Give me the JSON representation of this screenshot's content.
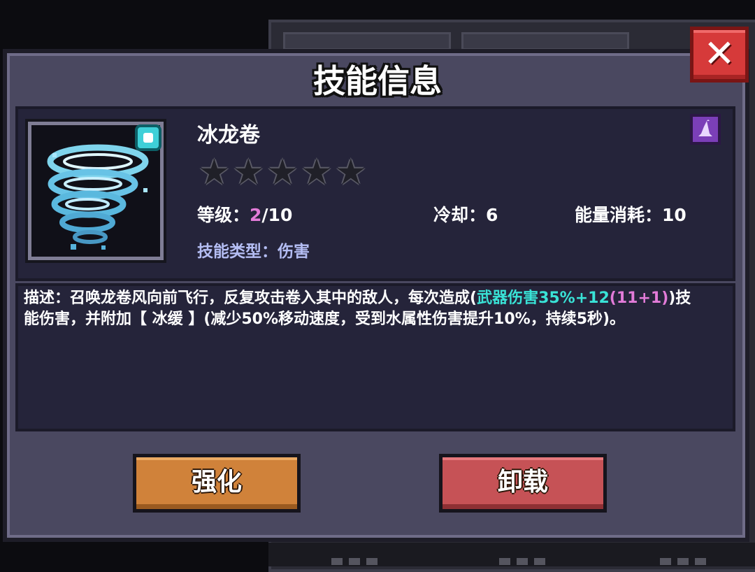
{
  "dialog": {
    "title": "技能信息",
    "close_label": "✕"
  },
  "skill": {
    "icon": "tornado-icon",
    "name": "冰龙卷",
    "stars_total": 5,
    "stars_filled": 0,
    "level_label": "等级：",
    "level_current": "2",
    "level_max": "/10",
    "cooldown": "冷却：6",
    "energy_cost": "能量消耗：10",
    "type": "技能类型：伤害",
    "class_badge_icon": "wizard-hat-icon"
  },
  "description": {
    "part1": "描述：召唤龙卷风向前飞行，反复攻击卷入其中的敌人，每次造成(",
    "damage_formula": "武器伤害35%+12",
    "upgrade_note": "(11+1)",
    "part2": ")技能伤害，并附加【 冰缓 】(减少50%移动速度，受到水属性伤害提升10%，持续5秒)。"
  },
  "buttons": {
    "upgrade": "强化",
    "unequip": "卸载"
  },
  "colors": {
    "highlight_pink": "#e27bd8",
    "highlight_cyan": "#39e2d6",
    "upgrade_button": "#d0823a",
    "unequip_button": "#c65256",
    "close_button": "#d63a3a"
  }
}
